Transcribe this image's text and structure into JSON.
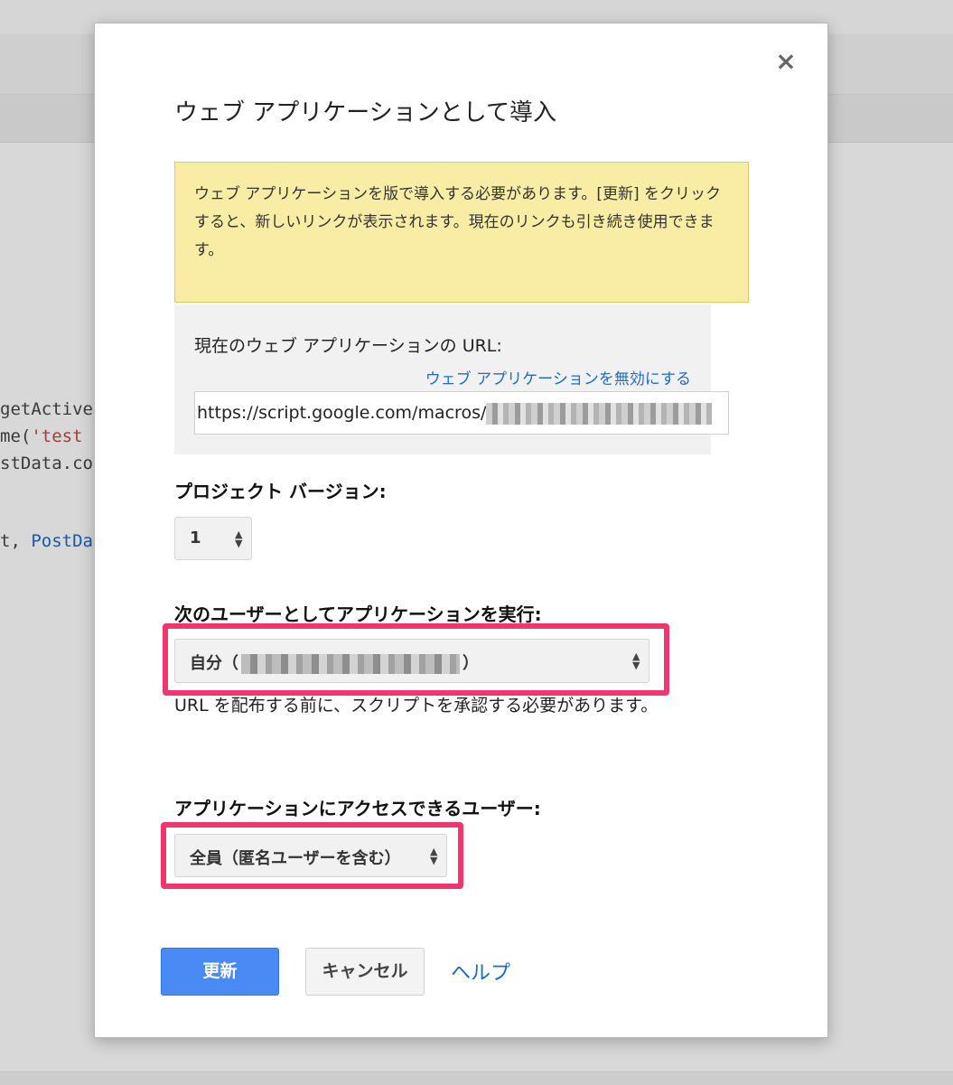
{
  "background": {
    "code_lines": [
      {
        "parts": [
          {
            "t": "getActive",
            "k": "plain"
          }
        ]
      },
      {
        "parts": [
          {
            "t": "me(",
            "k": "plain"
          },
          {
            "t": "'test",
            "k": "str"
          }
        ]
      },
      {
        "parts": [
          {
            "t": "stData.co",
            "k": "plain"
          }
        ]
      },
      {
        "parts": [
          {
            "t": "t, ",
            "k": "plain"
          },
          {
            "t": "PostDa",
            "k": "cls"
          }
        ]
      }
    ]
  },
  "dialog": {
    "close_icon": "×",
    "title": "ウェブ アプリケーションとして導入",
    "warning_text": "ウェブ アプリケーションを版で導入する必要があります。[更新] をクリックすると、新しいリンクが表示されます。現在のリンクも引き続き使用できます。",
    "current_url_label": "現在のウェブ アプリケーションの URL:",
    "disable_link": "ウェブ アプリケーションを無効にする",
    "current_url_value": "https://script.google.com/macros/",
    "project_version_label": "プロジェクト バージョン:",
    "project_version_value": "1",
    "execute_as_label": "次のユーザーとしてアプリケーションを実行:",
    "execute_as_prefix": "自分（",
    "execute_as_suffix": "）",
    "execute_note": "URL を配布する前に、スクリプトを承認する必要があります。",
    "access_label": "アプリケーションにアクセスできるユーザー:",
    "access_value": "全員（匿名ユーザーを含む）",
    "update_button": "更新",
    "cancel_button": "キャンセル",
    "help_link": "ヘルプ"
  },
  "colors": {
    "primary": "#4a8af4",
    "link": "#1a6bd1",
    "highlight": "#f0356f",
    "warning_bg": "#f9eda6"
  }
}
